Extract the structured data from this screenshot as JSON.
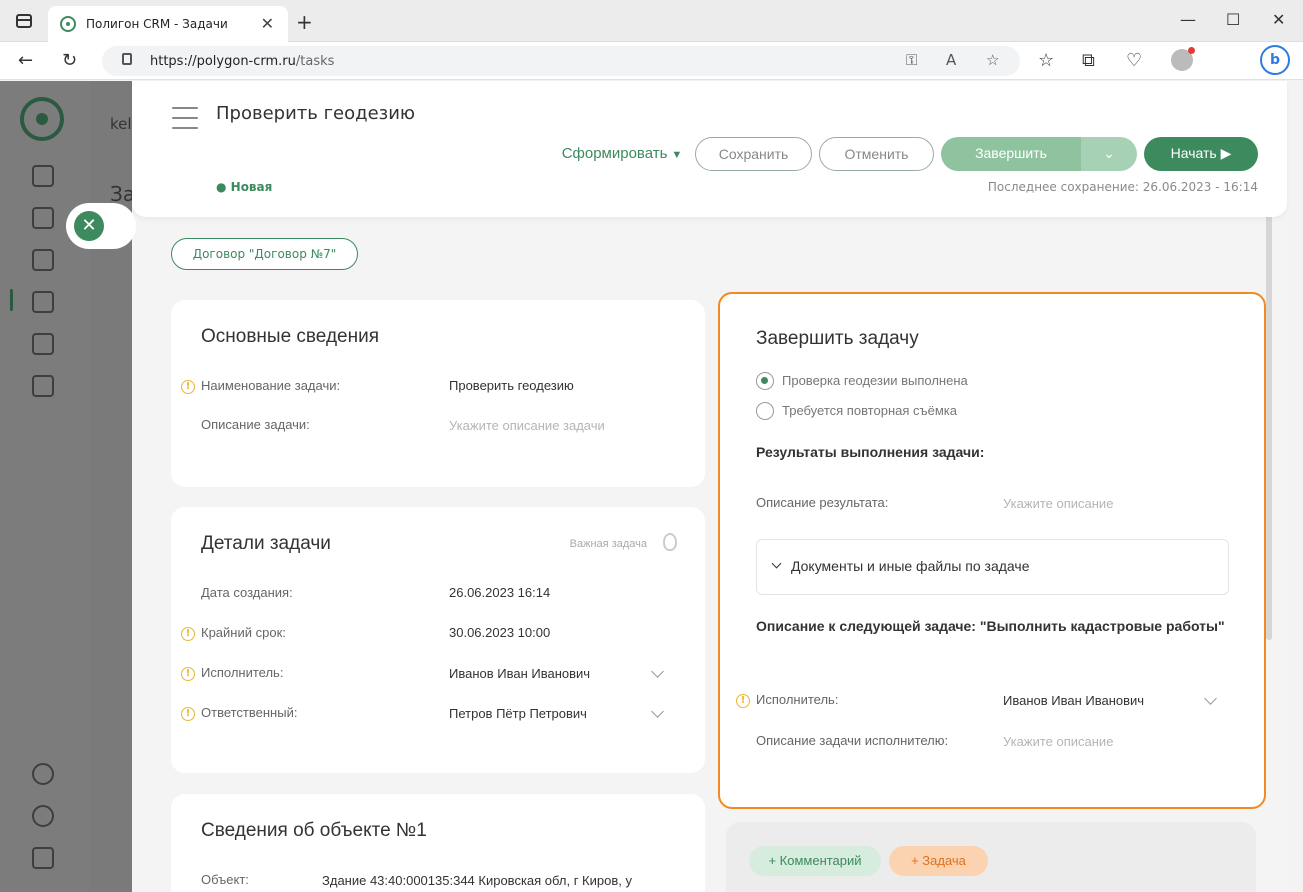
{
  "browser": {
    "tab_title": "Полигон CRM - Задачи",
    "url_host": "https://polygon-crm.ru",
    "url_path": "/tasks"
  },
  "background": {
    "partial_text": "kel",
    "partial_heading": "За"
  },
  "header": {
    "title": "Проверить геодезию",
    "status": "● Новая",
    "btn_form": "Сформировать",
    "btn_save": "Сохранить",
    "btn_cancel": "Отменить",
    "btn_finish": "Завершить",
    "btn_start": "Начать",
    "last_save": "Последнее сохранение: 26.06.2023 - 16:14"
  },
  "contract": {
    "label": "Договор \"Договор №7\""
  },
  "basic": {
    "title": "Основные сведения",
    "name_label": "Наименование задачи:",
    "name_value": "Проверить геодезию",
    "desc_label": "Описание задачи:",
    "desc_placeholder": "Укажите описание задачи"
  },
  "details": {
    "title": "Детали задачи",
    "important": "Важная задача",
    "created_label": "Дата создания:",
    "created_value": "26.06.2023 16:14",
    "deadline_label": "Крайний срок:",
    "deadline_value": "30.06.2023 10:00",
    "executor_label": "Исполнитель:",
    "executor_value": "Иванов Иван Иванович",
    "responsible_label": "Ответственный:",
    "responsible_value": "Петров Пётр Петрович"
  },
  "object": {
    "title": "Сведения об объекте №1",
    "object_label": "Объект:",
    "object_value": "Здание 43:40:000135:344 Кировская обл, г Киров, у"
  },
  "finish": {
    "title": "Завершить задачу",
    "option1": "Проверка геодезии выполнена",
    "option2": "Требуется повторная съёмка",
    "results_label": "Результаты выполнения задачи:",
    "result_desc_label": "Описание результата:",
    "result_desc_placeholder": "Укажите описание",
    "files_label": "Документы и иные файлы по задаче",
    "next_task_label": "Описание к следующей задаче: \"Выполнить кадастровые работы\"",
    "executor_label": "Исполнитель:",
    "executor_value": "Иванов Иван Иванович",
    "exec_desc_label": "Описание задачи исполнителю:",
    "exec_desc_placeholder": "Укажите описание"
  },
  "actions": {
    "comment": "+ Комментарий",
    "task": "+ Задача"
  },
  "colors": {
    "accent": "#3d8a5f",
    "highlight": "#f08a24",
    "warning": "#e8b830"
  }
}
